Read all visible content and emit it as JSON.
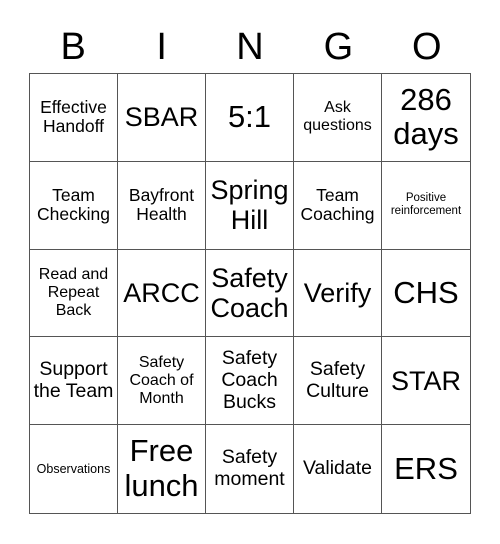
{
  "header": {
    "letters": [
      "B",
      "I",
      "N",
      "G",
      "O"
    ]
  },
  "cells": [
    {
      "text": "Effective Handoff",
      "size": "s-md"
    },
    {
      "text": "SBAR",
      "size": "s-xxl"
    },
    {
      "text": "5:1",
      "size": "s-big"
    },
    {
      "text": "Ask questions",
      "size": "s-sm"
    },
    {
      "text": "286 days",
      "size": "s-big"
    },
    {
      "text": "Team Checking",
      "size": "s-md"
    },
    {
      "text": "Bayfront Health",
      "size": "s-md"
    },
    {
      "text": "Spring Hill",
      "size": "s-xxl"
    },
    {
      "text": "Team Coaching",
      "size": "s-md"
    },
    {
      "text": "Positive reinforcement",
      "size": "s-xs"
    },
    {
      "text": "Read and Repeat Back",
      "size": "s-sm"
    },
    {
      "text": "ARCC",
      "size": "s-xxl"
    },
    {
      "text": "Safety Coach",
      "size": "s-xxl"
    },
    {
      "text": "Verify",
      "size": "s-xxl"
    },
    {
      "text": "CHS",
      "size": "s-big"
    },
    {
      "text": "Support the Team",
      "size": "s-lg"
    },
    {
      "text": "Safety Coach of Month",
      "size": "s-sm"
    },
    {
      "text": "Safety Coach Bucks",
      "size": "s-lg"
    },
    {
      "text": "Safety Culture",
      "size": "s-lg"
    },
    {
      "text": "STAR",
      "size": "s-xxl"
    },
    {
      "text": "Observations",
      "size": "s-xs2"
    },
    {
      "text": "Free lunch",
      "size": "s-big"
    },
    {
      "text": "Safety moment",
      "size": "s-lg"
    },
    {
      "text": "Validate",
      "size": "s-lg"
    },
    {
      "text": "ERS",
      "size": "s-big"
    }
  ]
}
